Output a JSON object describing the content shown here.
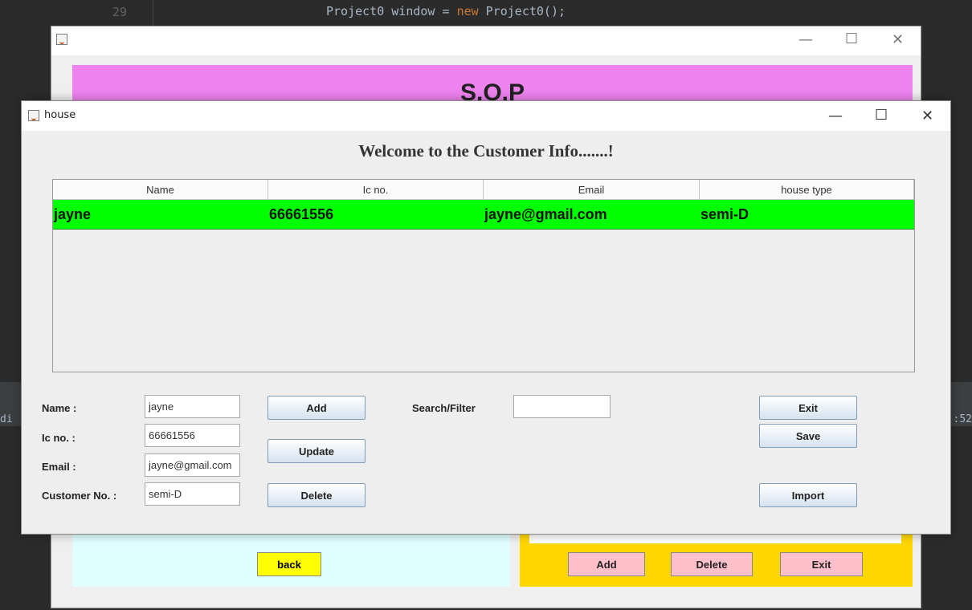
{
  "ide": {
    "line_number": "29",
    "code_prefix": "Project0 window = ",
    "code_keyword": "new",
    "code_suffix": " Project0();",
    "left_fragment": "di",
    "right_fragment": ":52"
  },
  "background_window": {
    "banner_title": "S.O.P",
    "back_label": "back",
    "yellow_field_text": "",
    "buttons": {
      "add": "Add",
      "delete": "Delete",
      "exit": "Exit"
    },
    "colors": {
      "banner": "#ee82ee",
      "cyan_panel": "#e0ffff",
      "yellow_panel": "#ffd700",
      "pink_button": "#ffc0cb",
      "back_button": "#ffff00"
    }
  },
  "window": {
    "title": "house",
    "controls": {
      "minimize": "—",
      "maximize": "☐",
      "close": "✕"
    },
    "heading": "Welcome to the Customer Info.......!",
    "table": {
      "columns": [
        "Name",
        "Ic no.",
        "Email",
        "house type"
      ],
      "rows": [
        {
          "name": "jayne",
          "ic": "66661556",
          "email": "jayne@gmail.com",
          "house_type": "semi-D"
        }
      ],
      "row_color": "#00ff00"
    },
    "form": {
      "name_label": "Name :",
      "name_value": "jayne",
      "ic_label": "Ic no. :",
      "ic_value": "66661556",
      "email_label": "Email :",
      "email_value": "jayne@gmail.com",
      "customer_label": "Customer No. :",
      "customer_value": "semi-D"
    },
    "buttons": {
      "add": "Add",
      "update": "Update",
      "delete": "Delete",
      "exit": "Exit",
      "save": "Save",
      "import": "Import"
    },
    "search": {
      "label": "Search/Filter",
      "value": ""
    }
  }
}
